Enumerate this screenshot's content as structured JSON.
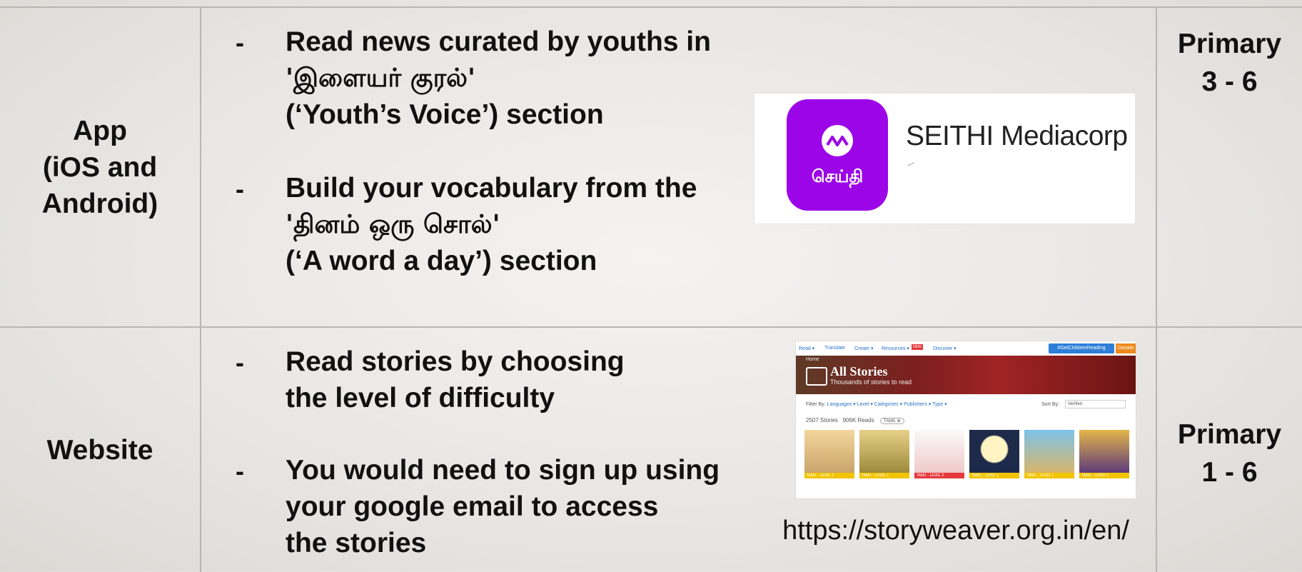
{
  "rows": [
    {
      "platform_lines": [
        "App",
        "(iOS and",
        "Android)"
      ],
      "items": [
        {
          "bullet": "-",
          "lines": [
            "Read news curated by youths in",
            "'இளையர் குரல்'",
            "(‘Youth’s Voice’) section"
          ]
        },
        {
          "bullet": "-",
          "lines": [
            "Build your vocabulary from the",
            "'தினம் ஒரு சொல்'",
            "(‘A word a day’) section"
          ]
        }
      ],
      "level_lines": [
        "Primary",
        "3 - 6"
      ],
      "app_card": {
        "icon_text": "செய்தி",
        "name": "SEITHI Mediacorp",
        "brand_color": "#9b05e8"
      }
    },
    {
      "platform_lines": [
        "Website"
      ],
      "items": [
        {
          "bullet": "-",
          "lines": [
            "Read stories by choosing",
            "the level of difficulty"
          ]
        },
        {
          "bullet": "-",
          "lines": [
            "You would need to sign up using",
            "your google email to access",
            "the stories"
          ]
        }
      ],
      "level_lines": [
        "Primary",
        "1 - 6"
      ],
      "site_preview": {
        "nav": [
          "Read ▾",
          "Translate",
          "Create ▾",
          "Resources ▾",
          "Discover ▾"
        ],
        "new_badge": "NEW",
        "cta": "#GetChildrenReading",
        "donate": "Donate",
        "home": "Home",
        "title": "All Stories",
        "subtitle": "Thousands of stories to read",
        "filter_label": "Filter By:",
        "filters": [
          "Languages ▾",
          "Level ▾",
          "Categories ▾",
          "Publishers ▾",
          "Type ▾"
        ],
        "sort_label": "Sort By:",
        "sort_value": "Verified",
        "stories_count": "2507 Stories",
        "reads_count": "906K Reads",
        "lang_tag": "TAMIL ⊗",
        "cards": [
          {
            "level": "TAMIL - LEVEL 1",
            "level_color": "#f2c400"
          },
          {
            "level": "TAMIL - LEVEL 1",
            "level_color": "#f2c400"
          },
          {
            "level": "TAMIL - LEVEL 2",
            "level_color": "#e5393d"
          },
          {
            "level": "TAMIL - LEVEL 1",
            "level_color": "#f2c400"
          },
          {
            "level": "TAMIL - LEVEL 1",
            "level_color": "#f2c400"
          },
          {
            "level": "TAMIL - LEVEL 1",
            "level_color": "#f2c400"
          }
        ]
      },
      "url": "https://storyweaver.org.in/en/"
    }
  ]
}
